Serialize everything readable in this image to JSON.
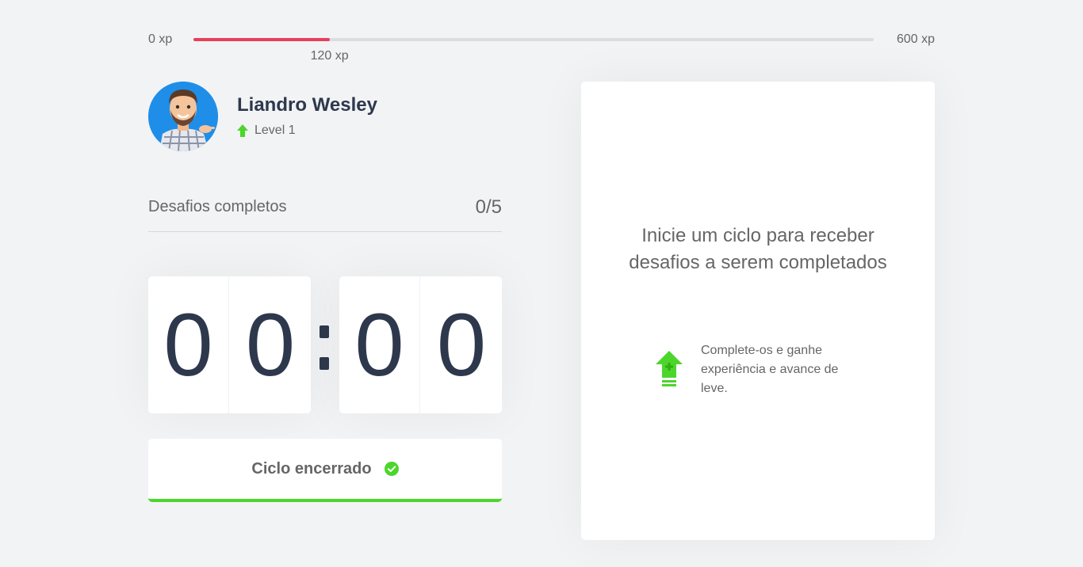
{
  "xp": {
    "min_label": "0 xp",
    "max_label": "600 xp",
    "current_label": "120 xp",
    "current": 120,
    "max": 600,
    "progress_color": "#e83f5b"
  },
  "profile": {
    "name": "Liandro Wesley",
    "level_label": "Level 1",
    "avatar_icon": "avatar-illustration"
  },
  "challenges_completed": {
    "label": "Desafios completos",
    "count": "0/5"
  },
  "countdown": {
    "minute_left": "0",
    "minute_right": "0",
    "second_left": "0",
    "second_right": "0"
  },
  "cycle_button": {
    "label": "Ciclo encerrado",
    "icon": "check-circle-icon",
    "accent_color": "#4cd62b"
  },
  "challenge_box": {
    "title": "Inicie um ciclo para receber desafios a serem completados",
    "hint": "Complete-os e ganhe experiência e avance de leve.",
    "icon": "level-up-icon"
  }
}
